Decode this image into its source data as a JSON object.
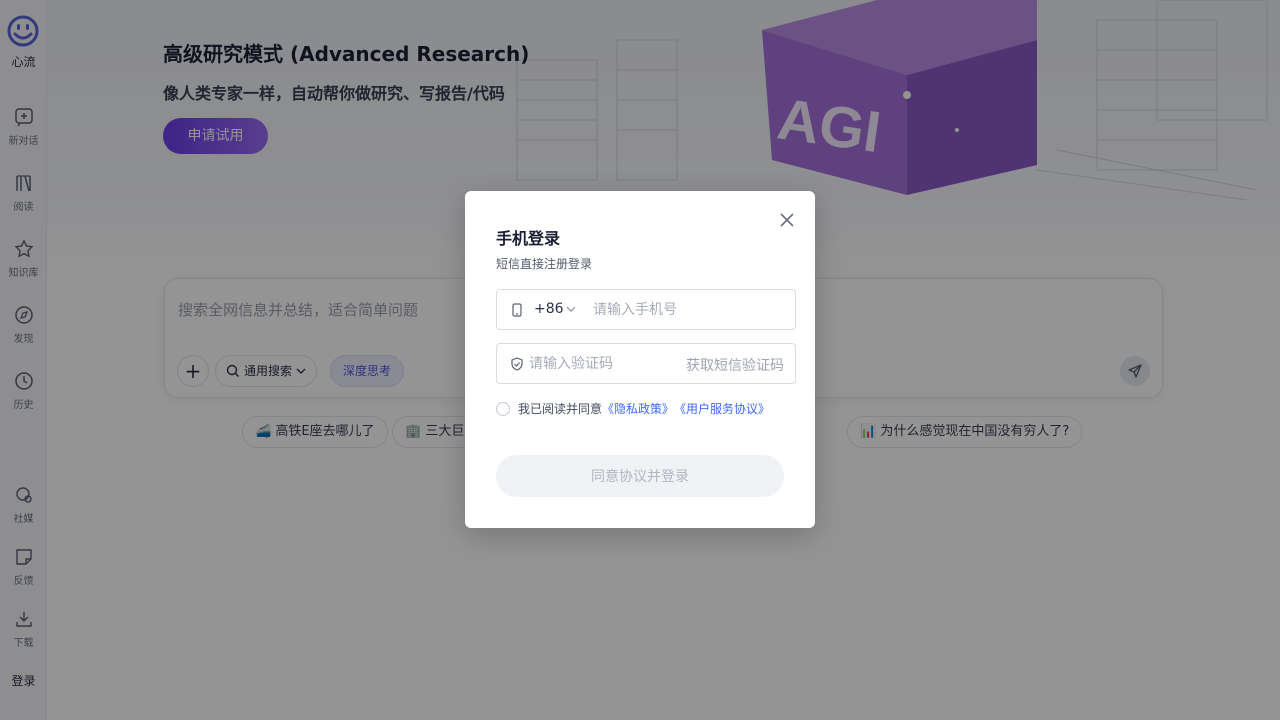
{
  "sidebar": {
    "logo_label": "心流",
    "items": [
      {
        "label": "新对话",
        "icon": "new-chat-icon"
      },
      {
        "label": "阅读",
        "icon": "books-icon"
      },
      {
        "label": "知识库",
        "icon": "knowledge-icon"
      },
      {
        "label": "发现",
        "icon": "compass-icon"
      },
      {
        "label": "历史",
        "icon": "clock-icon"
      },
      {
        "label": "社媒",
        "icon": "social-icon"
      },
      {
        "label": "反馈",
        "icon": "feedback-icon"
      },
      {
        "label": "下载",
        "icon": "download-icon"
      }
    ],
    "login_label": "登录"
  },
  "hero": {
    "title": "高级研究模式 (Advanced Research)",
    "subtitle": "像人类专家一样，自动帮你做研究、写报告/代码",
    "cta_label": "申请试用",
    "art_text": "AGI"
  },
  "search": {
    "placeholder": "搜索全网信息并总结，适合简单问题",
    "mode_label": "通用搜索",
    "deep_label": "深度思考"
  },
  "chips": [
    {
      "label": "高铁E座去哪儿了"
    },
    {
      "label": "三大巨头"
    },
    {
      "label": "？"
    },
    {
      "label": "为什么感觉现在中国没有穷人了?"
    }
  ],
  "login_modal": {
    "title": "手机登录",
    "subtitle": "短信直接注册登录",
    "country_code": "+86",
    "phone_placeholder": "请输入手机号",
    "code_placeholder": "请输入验证码",
    "get_code_label": "获取短信验证码",
    "agree_text": "我已阅读并同意",
    "privacy_link": "《隐私政策》",
    "terms_link": "《用户服务协议》",
    "submit_label": "同意协议并登录"
  },
  "colors": {
    "accent": "#6a3ee8",
    "link": "#3d6bf5",
    "overlay": "#000000"
  }
}
